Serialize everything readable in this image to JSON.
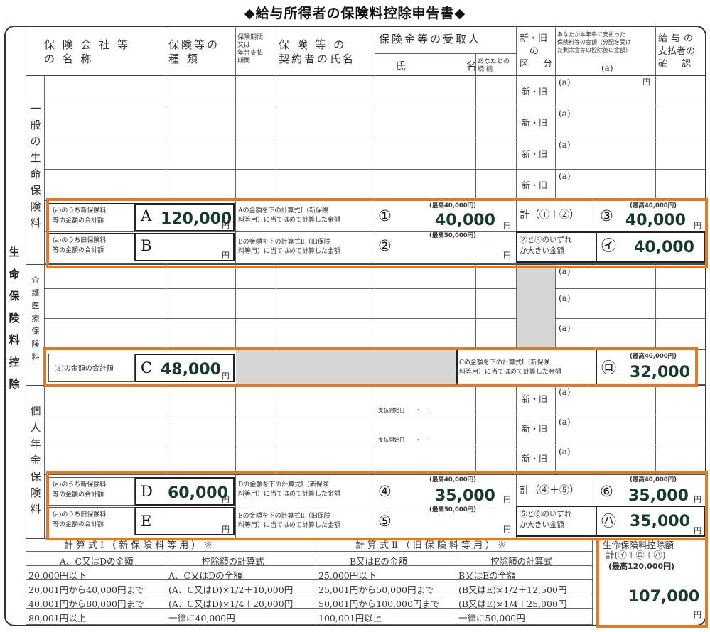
{
  "title": "◆給与所得者の保険料控除申告書◆",
  "side_label": "生命保険料控除",
  "headers": {
    "company": [
      "保 険 会 社 等",
      "の 名 称"
    ],
    "type": [
      "保険等の",
      "種 類"
    ],
    "period": [
      "保険期間",
      "又は",
      "年金支払",
      "期間"
    ],
    "contractor": [
      "保 険 等 の",
      "契約者の氏名"
    ],
    "recipient": "保険金等の受取人",
    "recipient_name": "氏 名",
    "recipient_rel": [
      "あなたとの",
      "続 柄"
    ],
    "newold": [
      "新・旧",
      "の",
      "区 分"
    ],
    "amount_desc": [
      "あなたが本年中に支払った",
      "保険料等の金額（分配を受け",
      "た剰余金等の控除後の金額）"
    ],
    "amount_a": "(a)",
    "confirm": [
      "給与の",
      "支払者の",
      "確 認"
    ]
  },
  "general": {
    "label": "一般の生命保険料",
    "newold": "新・旧",
    "a_mark": "(a)",
    "yen": "円",
    "new_label": [
      "(a)のうち新保険料",
      "等の金額の合計額"
    ],
    "old_label": [
      "(a)のうち旧保険料",
      "等の金額の合計額"
    ],
    "A": "A",
    "B": "B",
    "A_value": "120,000",
    "calc_new": [
      "Aの金額を下の計算式Ⅰ（新保険",
      "料等用）に当てはめて計算した金額"
    ],
    "calc_old": [
      "Bの金額を下の計算式Ⅱ（旧保険",
      "料等用）に当てはめて計算した金額"
    ],
    "c1": "①",
    "c2": "②",
    "max40": "(最高40,000円)",
    "max50": "(最高50,000円)",
    "v1": "40,000",
    "sum_label": "計（①＋②）",
    "c3": "③",
    "v3": "40,000",
    "greater": [
      "②と③のいずれ",
      "か大きい金額"
    ],
    "ci": "㋑",
    "vi": "40,000"
  },
  "care": {
    "label": "介護医療保険料",
    "a_mark": "(a)",
    "total_label": "(a)の金額の合計額",
    "C": "C",
    "C_value": "48,000",
    "yen": "円",
    "calc": [
      "Cの金額を下の計算式Ⅰ（新保険",
      "料等用）に当てはめて計算した金額"
    ],
    "max40": "(最高40,000円)",
    "cro": "㋺",
    "vro": "32,000"
  },
  "pension": {
    "label": "個人年金保険料",
    "newold": "新・旧",
    "a_mark": "(a)",
    "start": "支払開始日　　・　・",
    "yen": "円",
    "new_label": [
      "(a)のうち新保険料",
      "等の金額の合計額"
    ],
    "old_label": [
      "(a)のうち旧保険料",
      "等の金額の合計額"
    ],
    "D": "D",
    "E": "E",
    "D_value": "60,000",
    "calc_new": [
      "Dの金額を下の計算式Ⅰ（新保険",
      "料等用）に当てはめて計算した金額"
    ],
    "calc_old": [
      "Eの金額を下の計算式Ⅱ（旧保険",
      "料等用）に当てはめて計算した金額"
    ],
    "c4": "④",
    "c5": "⑤",
    "max40": "(最高40,000円)",
    "max50": "(最高50,000円)",
    "v4": "35,000",
    "sum_label": "計（④＋⑤）",
    "c6": "⑥",
    "v6": "35,000",
    "greater": [
      "⑤と⑥のいずれ",
      "か大きい金額"
    ],
    "cha": "㋩",
    "vha": "35,000"
  },
  "formula1": {
    "title": "計算式Ⅰ（新保険料等用）※",
    "col1": "A、C又はDの金額",
    "col2": "控除額の計算式",
    "rows": [
      [
        "20,000円以下",
        "A、C又はDの全額"
      ],
      [
        "20,001円から40,000円まで",
        "(A、C又はD)×1/2＋10,000円"
      ],
      [
        "40,001円から80,000円まで",
        "(A、C又はD)×1/4＋20,000円"
      ],
      [
        "80,001円以上",
        "一律に40,000円"
      ]
    ]
  },
  "formula2": {
    "title": "計算式Ⅱ（旧保険料等用）※",
    "col1": "B又はEの金額",
    "col2": "控除額の計算式",
    "rows": [
      [
        "25,000円以下",
        "B又はEの全額"
      ],
      [
        "25,001円から50,000円まで",
        "(B又はE)×1/2＋12,500円"
      ],
      [
        "50,001円から100,000円まで",
        "(B又はE)×1/4＋25,000円"
      ],
      [
        "100,001円以上",
        "一律に50,000円"
      ]
    ]
  },
  "total": {
    "label": [
      "生命保険料控除額",
      "計(㋑＋㋺＋㋩)"
    ],
    "max": "(最高120,000円)",
    "value": "107,000",
    "yen": "円"
  }
}
